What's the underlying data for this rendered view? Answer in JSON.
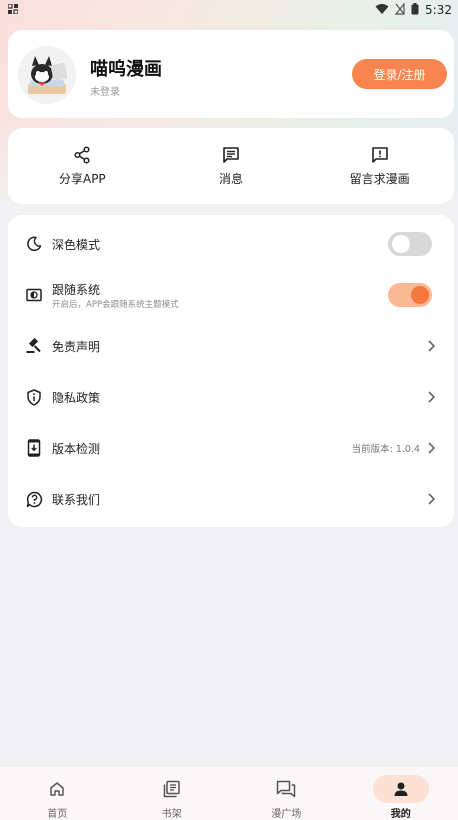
{
  "status_bar": {
    "time": "5:32"
  },
  "profile": {
    "app_name": "喵呜漫画",
    "login_state": "未登录",
    "login_button": "登录/注册"
  },
  "actions": [
    {
      "label": "分享APP",
      "icon": "share-icon"
    },
    {
      "label": "消息",
      "icon": "message-icon"
    },
    {
      "label": "留言求漫画",
      "icon": "feedback-icon"
    }
  ],
  "settings": {
    "dark_mode": {
      "label": "深色模式",
      "enabled": false
    },
    "follow_system": {
      "label": "跟随系统",
      "sublabel": "开启后，APP会跟随系统主题模式",
      "enabled": true
    },
    "disclaimer": {
      "label": "免责声明"
    },
    "privacy": {
      "label": "隐私政策"
    },
    "version_check": {
      "label": "版本检测",
      "value": "当前版本: 1.0.4"
    },
    "contact": {
      "label": "联系我们"
    }
  },
  "bottom_nav": [
    {
      "label": "首页",
      "icon": "home-icon",
      "active": false
    },
    {
      "label": "书架",
      "icon": "bookshelf-icon",
      "active": false
    },
    {
      "label": "漫广场",
      "icon": "forum-icon",
      "active": false
    },
    {
      "label": "我的",
      "icon": "person-icon",
      "active": true
    }
  ],
  "colors": {
    "accent": "#f8844f",
    "toggle_on_track": "#fbb895",
    "toggle_on_knob": "#f7783e",
    "nav_active_pill": "#fde1d4"
  }
}
